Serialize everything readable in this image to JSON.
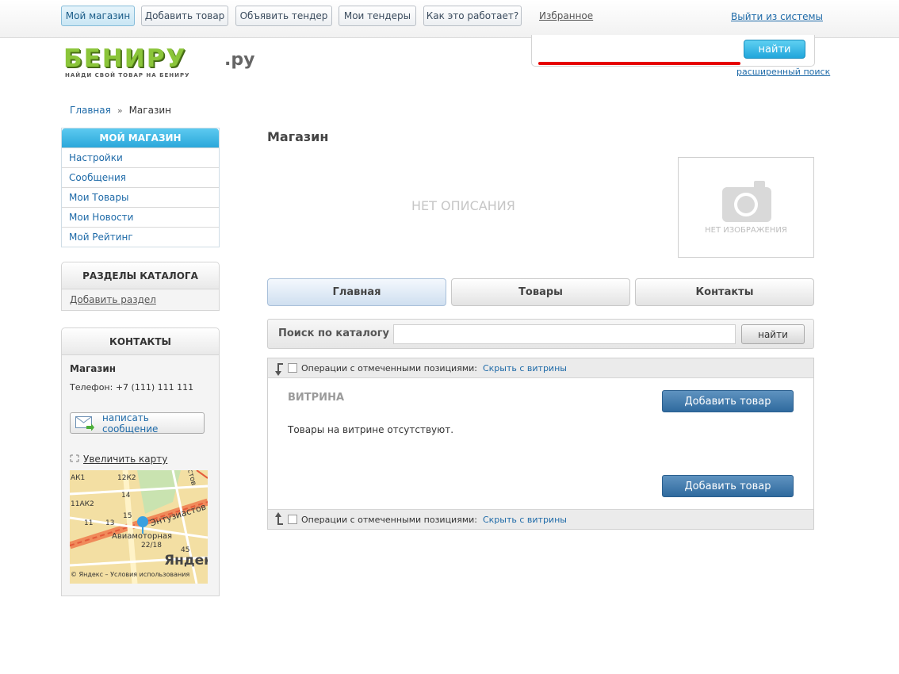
{
  "topnav": {
    "my_shop": "Мой магазин",
    "add_product": "Добавить товар",
    "announce_tender": "Объявить тендер",
    "my_tenders": "Мои тендеры",
    "how_it_works": "Как это работает?",
    "favorites": "Избранное",
    "logout": "Выйти из системы"
  },
  "logo": {
    "name": "БЕНИРУ",
    "suffix": ".ру",
    "tagline": "НАЙДИ СВОЙ ТОВАР НА БЕНИРУ"
  },
  "header_search": {
    "value": "",
    "button": "найти",
    "advanced": "расширенный поиск"
  },
  "breadcrumb": {
    "home": "Главная",
    "separator": "»",
    "current": "Магазин"
  },
  "sidebar": {
    "my_shop_title": "МОЙ МАГАЗИН",
    "menu": [
      {
        "label": "Настройки"
      },
      {
        "label": "Сообщения"
      },
      {
        "label": "Мои Товары"
      },
      {
        "label": "Мои Новости"
      },
      {
        "label": "Мой Рейтинг"
      }
    ],
    "catalog_title": "РАЗДЕЛЫ КАТАЛОГА",
    "add_section": "Добавить раздел",
    "contacts_title": "КОНТАКТЫ",
    "shop_name": "Магазин",
    "phone": "Телефон: +7 (111) 111 111",
    "write_message": "написать сообщение",
    "zoom_map": "Увеличить карту",
    "map_labels": {
      "street": "Энтузиастов",
      "metro": "Авиамоторная",
      "yandex": "Яндекс",
      "terms": "© Яндекс – Условия использования",
      "n1": "АК1",
      "n2": "12К2",
      "n3": "11АК2",
      "n4": "14",
      "n5": "11",
      "n6": "13",
      "n7": "15",
      "n8": "22/18",
      "n9": "45",
      "n10": "стов"
    }
  },
  "main": {
    "title": "Магазин",
    "no_description": "НЕТ ОПИСАНИЯ",
    "no_image": "НЕТ ИЗОБРАЖЕНИЯ",
    "tabs": [
      {
        "label": "Главная"
      },
      {
        "label": "Товары"
      },
      {
        "label": "Контакты"
      }
    ],
    "catalog_search": {
      "label": "Поиск по каталогу",
      "value": "",
      "button": "найти"
    },
    "operations_label": "Операции с отмеченными позициями:",
    "hide_from_showcase": "Скрыть с витрины",
    "showcase_title": "ВИТРИНА",
    "add_product": "Добавить товар",
    "empty_text": "Товары на витрине отсутствуют."
  },
  "colors": {
    "accent_blue": "#2ba7da",
    "logo_green": "#8bc53a",
    "link": "#1e6aa8",
    "underline_red": "#e60000",
    "button_blue": "#2f6a9e"
  }
}
